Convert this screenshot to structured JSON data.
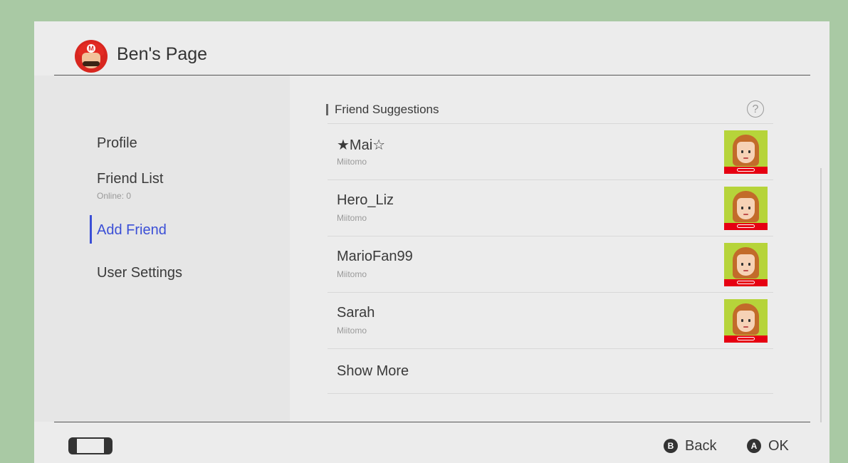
{
  "header": {
    "title": "Ben's Page",
    "avatar_icon": "mario-avatar-icon"
  },
  "sidebar": {
    "items": [
      {
        "label": "Profile",
        "sub": ""
      },
      {
        "label": "Friend List",
        "sub": "Online: 0"
      },
      {
        "label": "Add Friend",
        "sub": "",
        "active": true
      },
      {
        "label": "User Settings",
        "sub": ""
      }
    ]
  },
  "section": {
    "title": "Friend Suggestions",
    "help_icon": "question-icon"
  },
  "suggestions": [
    {
      "name": "★Mai☆",
      "source": "Miitomo"
    },
    {
      "name": "Hero_Liz",
      "source": "Miitomo"
    },
    {
      "name": "MarioFan99",
      "source": "Miitomo"
    },
    {
      "name": "Sarah",
      "source": "Miitomo"
    }
  ],
  "show_more": "Show More",
  "footer": {
    "console_icon": "switch-console-icon",
    "back": {
      "button": "B",
      "label": "Back"
    },
    "ok": {
      "button": "A",
      "label": "OK"
    }
  },
  "colors": {
    "background": "#a9c9a4",
    "panel": "#ececec",
    "accent": "#3b4fd6",
    "mii_bg": "#b6d43a",
    "nintendo_red": "#e60012"
  }
}
